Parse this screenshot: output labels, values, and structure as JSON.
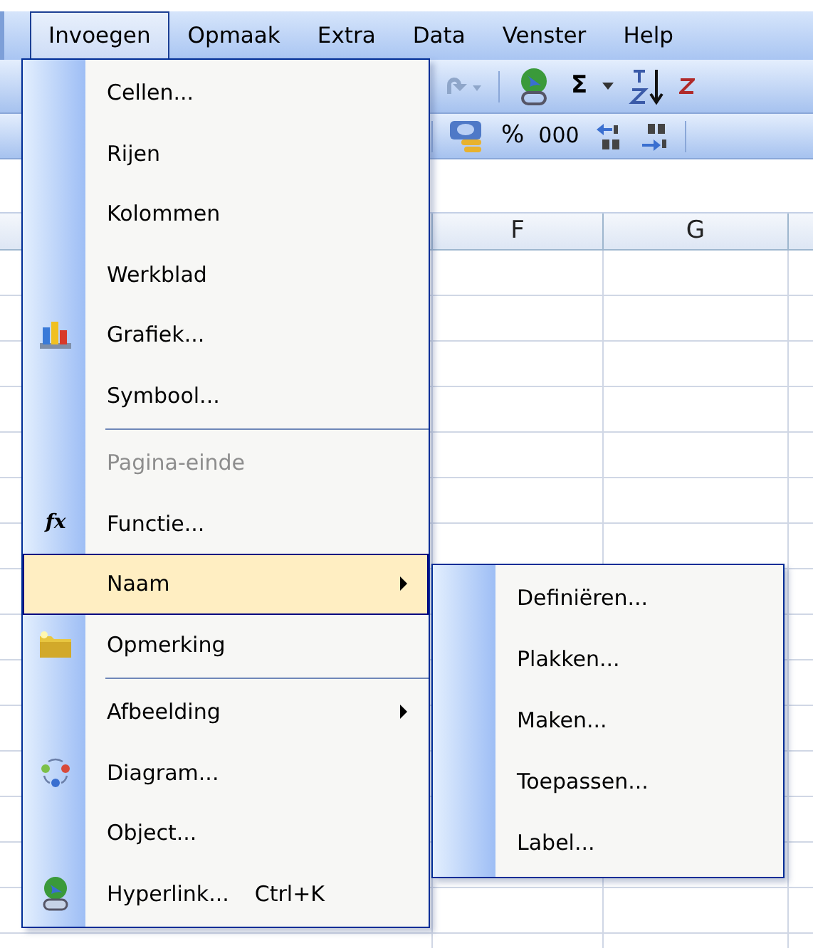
{
  "menubar": [
    {
      "label": "Invoegen",
      "selected": true
    },
    {
      "label": "Opmaak",
      "selected": false
    },
    {
      "label": "Extra",
      "selected": false
    },
    {
      "label": "Data",
      "selected": false
    },
    {
      "label": "Venster",
      "selected": false
    },
    {
      "label": "Help",
      "selected": false
    }
  ],
  "toolbar_1": {
    "sum_button": "Σ"
  },
  "toolbar_2": {
    "percent_button": "%",
    "thousands_button": "000"
  },
  "sheet": {
    "columns": [
      "F",
      "G"
    ]
  },
  "menu": {
    "items": [
      {
        "kind": "command",
        "label": "Cellen...",
        "disabled": false,
        "selected": false,
        "has_submenu": false
      },
      {
        "kind": "command",
        "label": "Rijen",
        "disabled": false,
        "selected": false,
        "has_submenu": false
      },
      {
        "kind": "command",
        "label": "Kolommen",
        "disabled": false,
        "selected": false,
        "has_submenu": false
      },
      {
        "kind": "command",
        "label": "Werkblad",
        "disabled": false,
        "selected": false,
        "has_submenu": false
      },
      {
        "kind": "command",
        "label": "Grafiek...",
        "disabled": false,
        "selected": false,
        "has_submenu": false
      },
      {
        "kind": "command",
        "label": "Symbool...",
        "disabled": false,
        "selected": false,
        "has_submenu": false
      },
      {
        "kind": "separator"
      },
      {
        "kind": "command",
        "label": "Pagina-einde",
        "disabled": true,
        "selected": false,
        "has_submenu": false
      },
      {
        "kind": "command",
        "label": "Functie...",
        "icon_text": "fx",
        "disabled": false,
        "selected": false,
        "has_submenu": false
      },
      {
        "kind": "command",
        "label": "Naam",
        "disabled": false,
        "selected": true,
        "has_submenu": true
      },
      {
        "kind": "command",
        "label": "Opmerking",
        "disabled": false,
        "selected": false,
        "has_submenu": false
      },
      {
        "kind": "separator"
      },
      {
        "kind": "command",
        "label": "Afbeelding",
        "disabled": false,
        "selected": false,
        "has_submenu": true
      },
      {
        "kind": "command",
        "label": "Diagram...",
        "disabled": false,
        "selected": false,
        "has_submenu": false
      },
      {
        "kind": "command",
        "label": "Object...",
        "disabled": false,
        "selected": false,
        "has_submenu": false
      },
      {
        "kind": "command",
        "label": "Hyperlink...",
        "shortcut": "Ctrl+K",
        "disabled": false,
        "selected": false,
        "has_submenu": false
      }
    ]
  },
  "submenu": {
    "items": [
      {
        "label": "Definiëren..."
      },
      {
        "label": "Plakken..."
      },
      {
        "label": "Maken..."
      },
      {
        "label": "Toepassen..."
      },
      {
        "label": "Label..."
      }
    ]
  }
}
